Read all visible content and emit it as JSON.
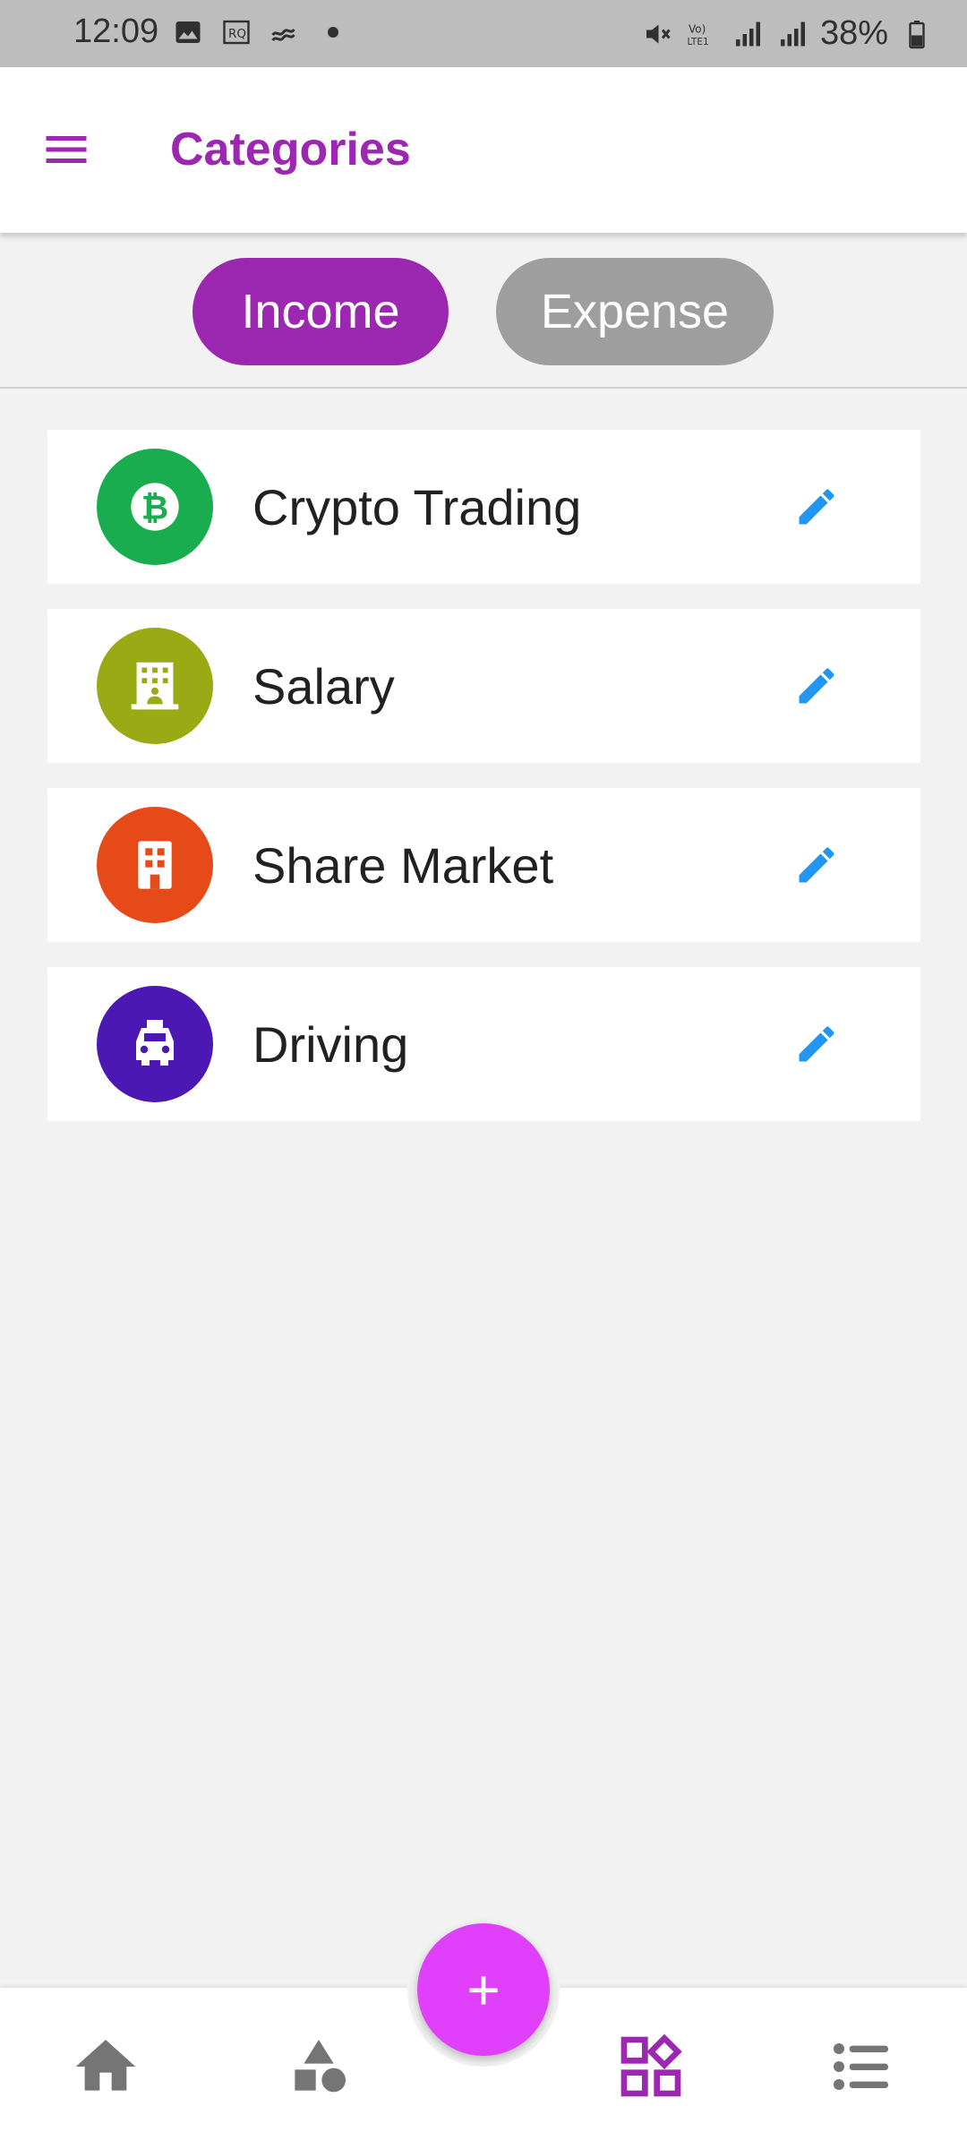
{
  "status_bar": {
    "time": "12:09",
    "battery": "38%",
    "icons_left": [
      "gallery-icon",
      "rq-icon",
      "signal-wave-icon",
      "dot-icon"
    ],
    "icons_right": [
      "mute-icon",
      "volte-icon",
      "signal-icon",
      "signal-icon",
      "battery-icon"
    ]
  },
  "app_bar": {
    "title": "Categories",
    "menu_icon": "menu-icon"
  },
  "tabs": [
    {
      "label": "Income",
      "selected": true
    },
    {
      "label": "Expense",
      "selected": false
    }
  ],
  "categories": [
    {
      "label": "Crypto Trading",
      "icon": "bitcoin-icon",
      "color": "#1aad4f"
    },
    {
      "label": "Salary",
      "icon": "office-building-icon",
      "color": "#9aaa14"
    },
    {
      "label": "Share Market",
      "icon": "building-icon",
      "color": "#e64a19"
    },
    {
      "label": "Driving",
      "icon": "taxi-icon",
      "color": "#4b18b3"
    }
  ],
  "fab": {
    "label": "+"
  },
  "bottom_nav": [
    {
      "name": "home",
      "icon": "home-icon",
      "active": false
    },
    {
      "name": "shapes",
      "icon": "shapes-icon",
      "active": false
    },
    {
      "name": "categories",
      "icon": "categories-grid-icon",
      "active": true
    },
    {
      "name": "list",
      "icon": "list-icon",
      "active": false
    }
  ],
  "colors": {
    "accent": "#9c27b0",
    "fab": "#e040fb",
    "edit": "#2196f3",
    "inactive": "#757575"
  }
}
